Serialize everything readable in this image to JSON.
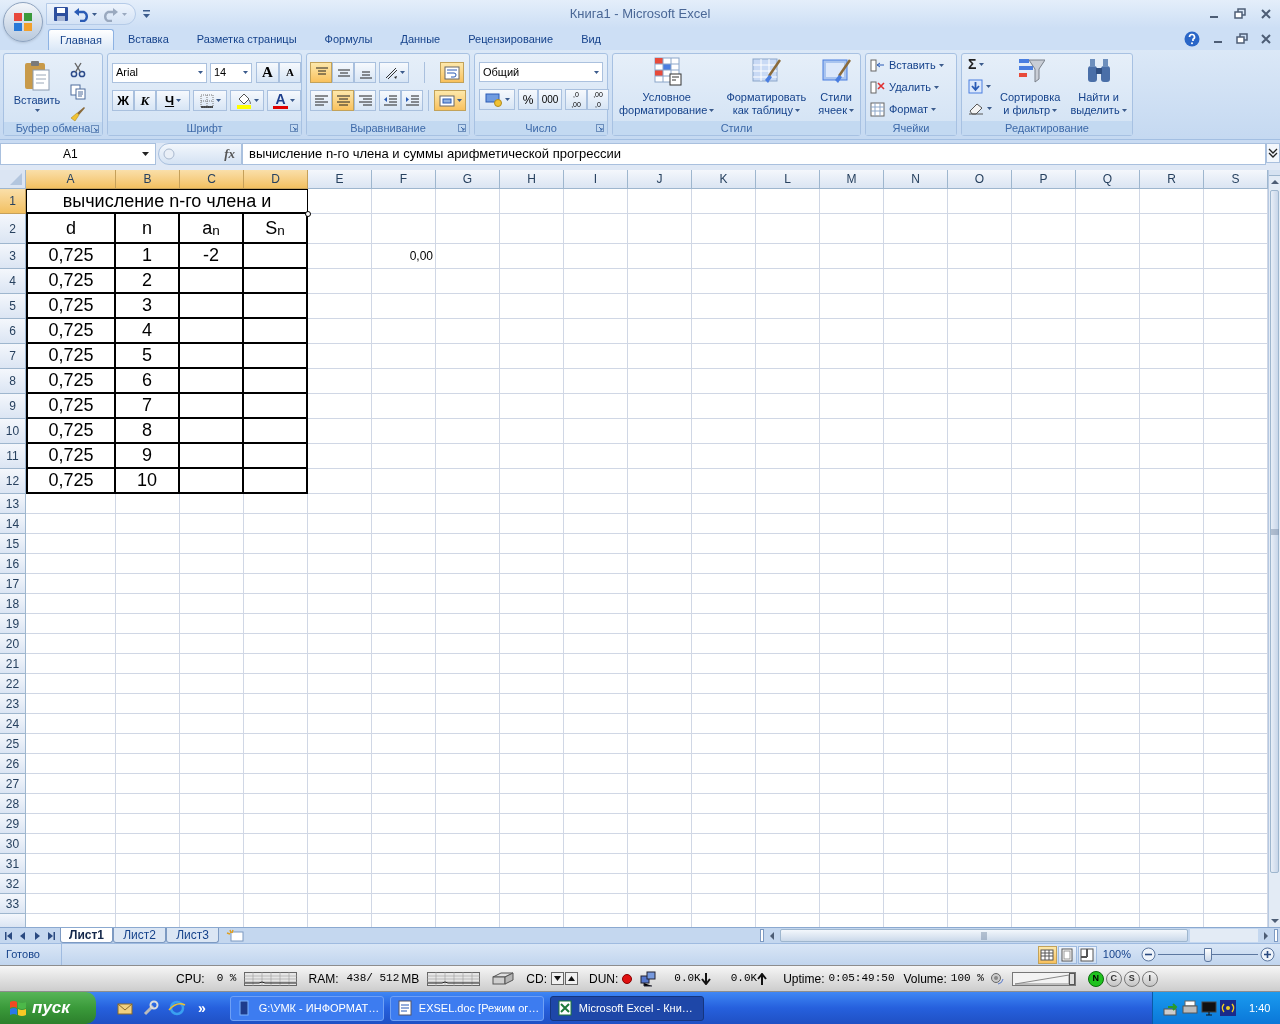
{
  "window": {
    "title": "Книга1 - Microsoft Excel"
  },
  "ribbon_tabs": [
    {
      "label": "Главная",
      "selected": true
    },
    {
      "label": "Вставка",
      "selected": false
    },
    {
      "label": "Разметка страницы",
      "selected": false
    },
    {
      "label": "Формулы",
      "selected": false
    },
    {
      "label": "Данные",
      "selected": false
    },
    {
      "label": "Рецензирование",
      "selected": false
    },
    {
      "label": "Вид",
      "selected": false
    }
  ],
  "clipboard": {
    "label": "Буфер обмена",
    "paste": "Вставить"
  },
  "font": {
    "label": "Шрифт",
    "name": "Arial",
    "size": "14",
    "grow": "A",
    "shrink": "A",
    "bold": "Ж",
    "italic": "К",
    "underline": "Ч",
    "color_letter": "A"
  },
  "alignment": {
    "label": "Выравнивание",
    "vertical": [
      {
        "selected": true
      },
      {
        "selected": false
      },
      {
        "selected": false
      }
    ],
    "horizontal": [
      {
        "selected": false
      },
      {
        "selected": true
      },
      {
        "selected": false
      }
    ],
    "wrap_text": {
      "selected": true
    },
    "merge": {
      "selected": true
    }
  },
  "number": {
    "label": "Число",
    "format": "Общий",
    "percent": "%",
    "thousands": "000",
    "decimals": [
      {
        "lines": [
          ",0",
          ",00"
        ]
      },
      {
        "lines": [
          ",00",
          ",0"
        ]
      }
    ]
  },
  "styles": {
    "label": "Стили",
    "buttons": [
      {
        "lines": [
          "Условное",
          "форматирование"
        ]
      },
      {
        "lines": [
          "Форматировать",
          "как таблицу"
        ]
      },
      {
        "lines": [
          "Стили",
          "ячеек"
        ]
      }
    ]
  },
  "cells": {
    "label": "Ячейки",
    "buttons": [
      "Вставить",
      "Удалить",
      "Формат"
    ]
  },
  "editing": {
    "label": "Редактирование",
    "sum": "Σ",
    "buttons": [
      {
        "lines": [
          "Сортировка",
          "и фильтр"
        ]
      },
      {
        "lines": [
          "Найти и",
          "выделить"
        ]
      }
    ]
  },
  "formula_bar": {
    "name_box": "A1",
    "function_label": "fx",
    "formula": "вычисление n-го члена и суммы арифметической прогрессии"
  },
  "sheet": {
    "columns": [
      {
        "label": "A",
        "selected": true
      },
      {
        "label": "B",
        "selected": true
      },
      {
        "label": "C",
        "selected": true
      },
      {
        "label": "D",
        "selected": true
      },
      {
        "label": "E",
        "selected": false
      },
      {
        "label": "F",
        "selected": false
      },
      {
        "label": "G",
        "selected": false
      },
      {
        "label": "H",
        "selected": false
      },
      {
        "label": "I",
        "selected": false
      },
      {
        "label": "J",
        "selected": false
      },
      {
        "label": "K",
        "selected": false
      },
      {
        "label": "L",
        "selected": false
      },
      {
        "label": "M",
        "selected": false
      },
      {
        "label": "N",
        "selected": false
      },
      {
        "label": "O",
        "selected": false
      },
      {
        "label": "P",
        "selected": false
      },
      {
        "label": "Q",
        "selected": false
      },
      {
        "label": "R",
        "selected": false
      },
      {
        "label": "S",
        "selected": false
      }
    ],
    "rows": [
      {
        "label": "1",
        "selected": true
      },
      {
        "label": "2",
        "selected": false
      },
      {
        "label": "3",
        "selected": false
      },
      {
        "label": "4",
        "selected": false
      },
      {
        "label": "5",
        "selected": false
      },
      {
        "label": "6",
        "selected": false
      },
      {
        "label": "7",
        "selected": false
      },
      {
        "label": "8",
        "selected": false
      },
      {
        "label": "9",
        "selected": false
      },
      {
        "label": "10",
        "selected": false
      },
      {
        "label": "11",
        "selected": false
      },
      {
        "label": "12",
        "selected": false
      },
      {
        "label": "13",
        "selected": false
      },
      {
        "label": "14",
        "selected": false
      },
      {
        "label": "15",
        "selected": false
      },
      {
        "label": "16",
        "selected": false
      },
      {
        "label": "17",
        "selected": false
      },
      {
        "label": "18",
        "selected": false
      },
      {
        "label": "19",
        "selected": false
      },
      {
        "label": "20",
        "selected": false
      },
      {
        "label": "21",
        "selected": false
      },
      {
        "label": "22",
        "selected": false
      },
      {
        "label": "23",
        "selected": false
      },
      {
        "label": "24",
        "selected": false
      },
      {
        "label": "25",
        "selected": false
      },
      {
        "label": "26",
        "selected": false
      },
      {
        "label": "27",
        "selected": false
      },
      {
        "label": "28",
        "selected": false
      },
      {
        "label": "29",
        "selected": false
      },
      {
        "label": "30",
        "selected": false
      },
      {
        "label": "31",
        "selected": false
      },
      {
        "label": "32",
        "selected": false
      },
      {
        "label": "33",
        "selected": false
      }
    ],
    "merged_title": "вычисление n-го члена и",
    "table_headers": [
      "d",
      "n",
      "a$_{n}$",
      "S$_{n}$"
    ],
    "table_rows": [
      {
        "cells": [
          "0,725",
          "1",
          "-2"
        ],
        "column_f": "0,00"
      },
      {
        "cells": [
          "0,725",
          "2"
        ]
      },
      {
        "cells": [
          "0,725",
          "3"
        ]
      },
      {
        "cells": [
          "0,725",
          "4"
        ]
      },
      {
        "cells": [
          "0,725",
          "5"
        ]
      },
      {
        "cells": [
          "0,725",
          "6"
        ]
      },
      {
        "cells": [
          "0,725",
          "7"
        ]
      },
      {
        "cells": [
          "0,725",
          "8"
        ]
      },
      {
        "cells": [
          "0,725",
          "9"
        ]
      },
      {
        "cells": [
          "0,725",
          "10"
        ]
      }
    ]
  },
  "sheet_tabs": [
    {
      "label": "Лист1",
      "selected": true
    },
    {
      "label": "Лист2",
      "selected": false
    },
    {
      "label": "Лист3",
      "selected": false
    }
  ],
  "status_bar": {
    "text": "Готово",
    "views": [
      {
        "selected": true
      },
      {
        "selected": false
      },
      {
        "selected": false
      }
    ],
    "zoom": "100%",
    "zoom_slider": {
      "level": 0.5
    }
  },
  "system_monitor": {
    "cpu_label": "CPU:",
    "cpu": "0 %",
    "ram_label": "RAM:",
    "ram": "438/ 512",
    "ram_unit": "MB",
    "cd_label": "CD:",
    "dun_label": "DUN:",
    "down": "0.0K",
    "up": "0.0K",
    "uptime_label": "Uptime:",
    "uptime": "0:05:49:50",
    "volume_label": "Volume:",
    "volume": "100 %",
    "volume_slider": {
      "level": 1
    },
    "buttons": [
      {
        "label": "N",
        "on": true
      },
      {
        "label": "C",
        "on": false
      },
      {
        "label": "S",
        "on": false
      },
      {
        "label": "I",
        "on": false
      }
    ]
  },
  "taskbar": {
    "start": "пуск",
    "more": "»",
    "tasks": [
      {
        "label": "G:\\УМК - ИНФОРМАТ…",
        "selected": false
      },
      {
        "label": "EXSEL.doc [Режим ог…",
        "selected": false
      },
      {
        "label": "Microsoft Excel - Кни…",
        "selected": true
      }
    ],
    "clock": "1:40"
  }
}
